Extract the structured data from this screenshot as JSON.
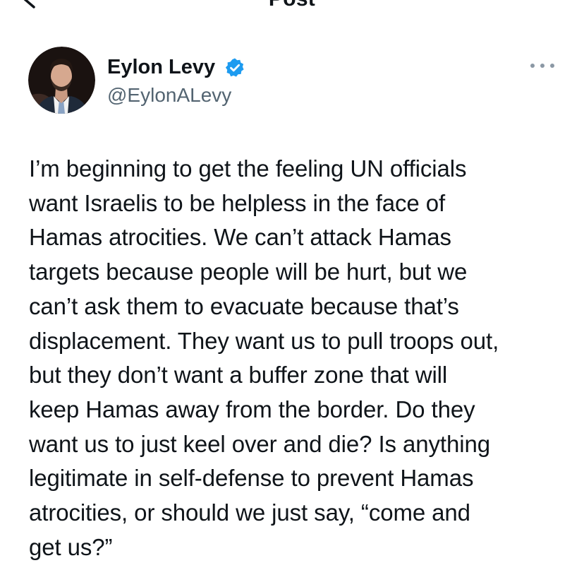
{
  "header": {
    "title": "Post"
  },
  "author": {
    "display_name": "Eylon Levy",
    "handle": "@EylonALevy",
    "verified": true,
    "verified_color": "#1d9bf0"
  },
  "tweet": {
    "text": "I’m beginning to get the feeling UN officials\nwant Israelis to be helpless in the face of\nHamas atrocities. We can’t attack Hamas\ntargets because people will be hurt, but we\ncan’t ask them to evacuate because that’s\ndisplacement. They want us to pull troops out,\nbut they don’t want a buffer zone that will\nkeep Hamas away from the border. Do they\nwant us to just keel over and die? Is anything\nlegitimate in self-defense to prevent Hamas\natrocities, or should we just say, “come and\nget us?”"
  },
  "icons": {
    "back": "chevron-left-icon",
    "more": "more-horizontal-icon",
    "verified": "verified-badge-icon"
  }
}
